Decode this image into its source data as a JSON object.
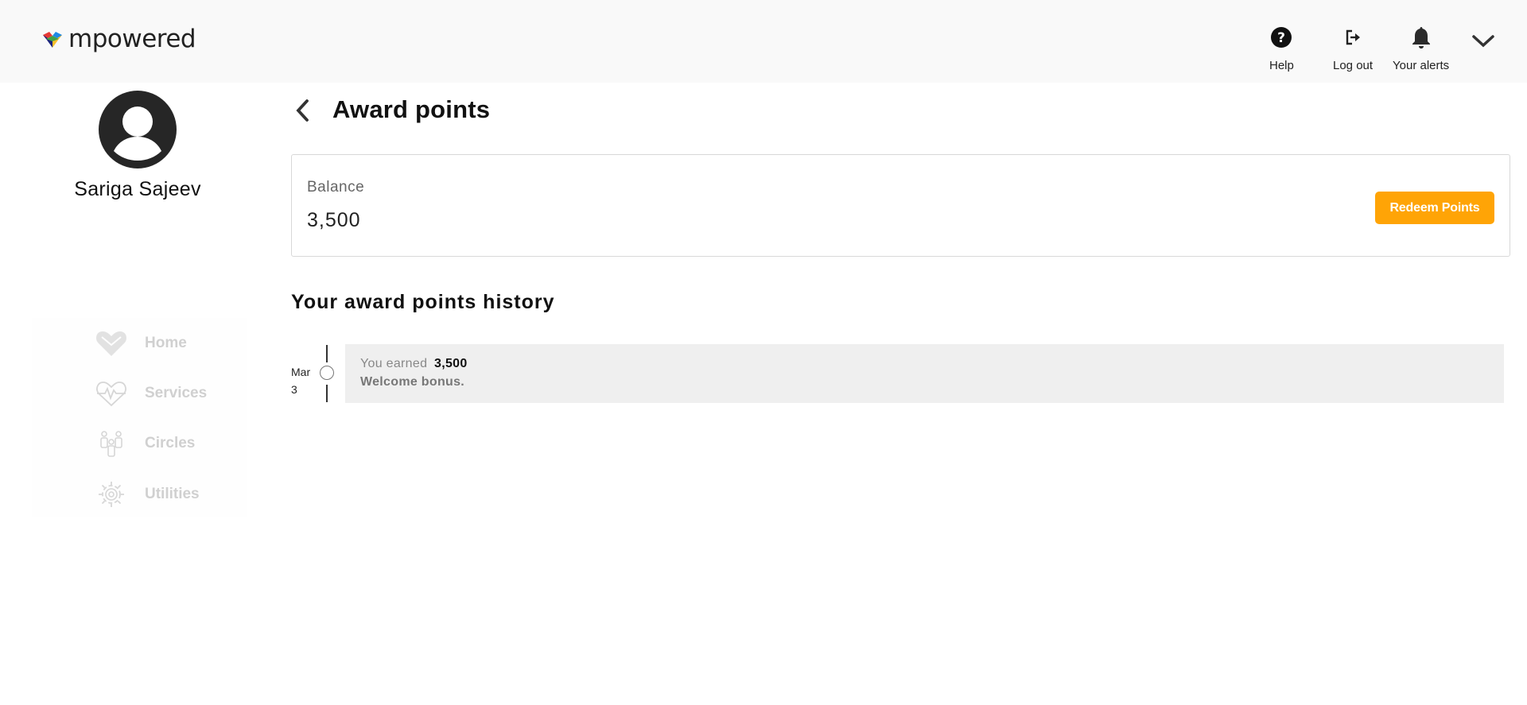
{
  "header": {
    "logo_text": "mpowered",
    "help_label": "Help",
    "logout_label": "Log out",
    "alerts_label": "Your alerts"
  },
  "profile": {
    "name": "Sariga Sajeev"
  },
  "nav": {
    "items": [
      {
        "label": "Home",
        "icon": "heart-logo-icon"
      },
      {
        "label": "Services",
        "icon": "heartbeat-icon"
      },
      {
        "label": "Circles",
        "icon": "people-icon"
      },
      {
        "label": "Utilities",
        "icon": "gear-icon"
      }
    ]
  },
  "page": {
    "title": "Award points"
  },
  "balance": {
    "label": "Balance",
    "value": "3,500",
    "redeem_label": "Redeem Points"
  },
  "history": {
    "title": "Your award points history",
    "entries": [
      {
        "month": "Mar",
        "day": "3",
        "earned_prefix": "You earned",
        "amount": "3,500",
        "description": "Welcome bonus."
      }
    ]
  },
  "colors": {
    "accent": "#ffa406",
    "header_bg": "#f9f9f9",
    "entry_bg": "#efefef",
    "nav_disabled": "#d0d0d0"
  }
}
